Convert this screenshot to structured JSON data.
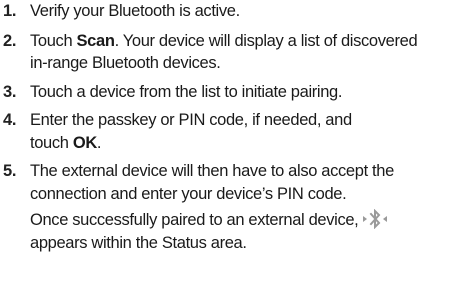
{
  "steps": [
    {
      "number": "1.",
      "lines": [
        "Verify your Bluetooth is active."
      ]
    },
    {
      "number": "2.",
      "pre": "Touch ",
      "bold": "Scan",
      "post": ". Your device will display a list of discovered",
      "line2": "in-range Bluetooth devices."
    },
    {
      "number": "3.",
      "lines": [
        "Touch a device from the list to initiate pairing."
      ]
    },
    {
      "number": "4.",
      "line1": "Enter the passkey or PIN code, if needed, and",
      "pre2": "touch ",
      "bold": "OK",
      "post2": "."
    },
    {
      "number": "5.",
      "line1": "The external device will then have to also accept the",
      "line2": "connection and enter your device’s PIN code.",
      "cont1": "Once successfully paired to an external device,",
      "cont2": "appears within the Status area.",
      "icon": "bluetooth-connected-icon"
    }
  ]
}
